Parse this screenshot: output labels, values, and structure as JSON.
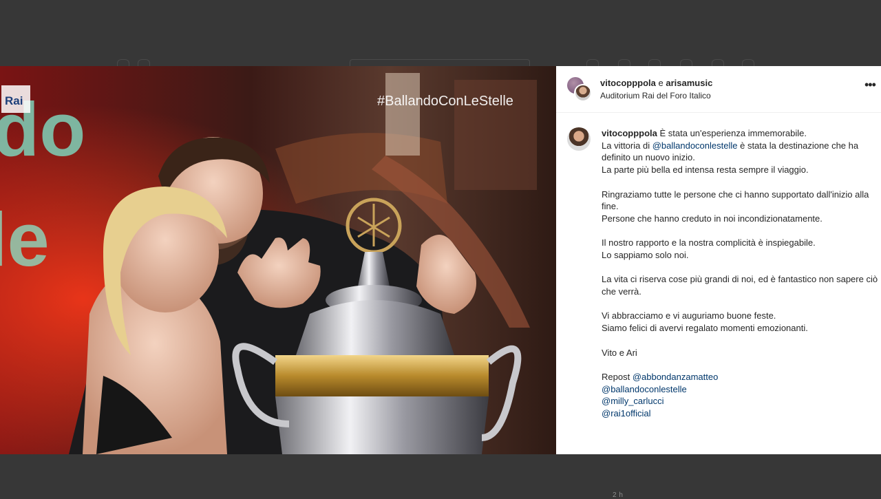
{
  "post": {
    "image_overlay": {
      "hashtag": "#BallandoConLeStelle",
      "channel_logo": "Rai",
      "show_logo_letters_top": "do",
      "show_logo_letters_bottom": "le"
    },
    "header": {
      "user1": "vitocopppola",
      "conjunction": "e",
      "user2": "arisamusic",
      "location": "Auditorium Rai del Foro Italico",
      "more_icon": "more-horizontal-icon"
    },
    "caption": {
      "author": "vitocopppola",
      "line1": " È stata un'esperienza immemorabile.",
      "line2_prefix": "La vittoria di ",
      "line2_mention": "@ballandoconlestelle",
      "line2_suffix": " è stata la destinazione che ha definito un nuovo inizio.",
      "line3": "La parte più bella ed intensa resta sempre il viaggio.",
      "para2_line1": "Ringraziamo tutte le persone che ci hanno supportato dall'inizio alla fine.",
      "para2_line2": "Persone che hanno creduto in noi incondizionatamente.",
      "para3_line1": "Il nostro rapporto e la nostra complicità è inspiegabile.",
      "para3_line2": "Lo sappiamo solo noi.",
      "para4": "La vita ci riserva cose più grandi di noi, ed è fantastico non sapere ciò che verrà.",
      "para5_line1": "Vi abbracciamo e vi auguriamo buone feste.",
      "para5_line2": "Siamo felici di avervi regalato momenti emozionanti.",
      "signature": "Vito e Ari",
      "repost_label": "Repost ",
      "mentions": [
        "@abbondanzamatteo",
        "@ballandoconlestelle",
        "@milly_carlucci",
        "@rai1official"
      ]
    },
    "timestamp": "2 h"
  }
}
